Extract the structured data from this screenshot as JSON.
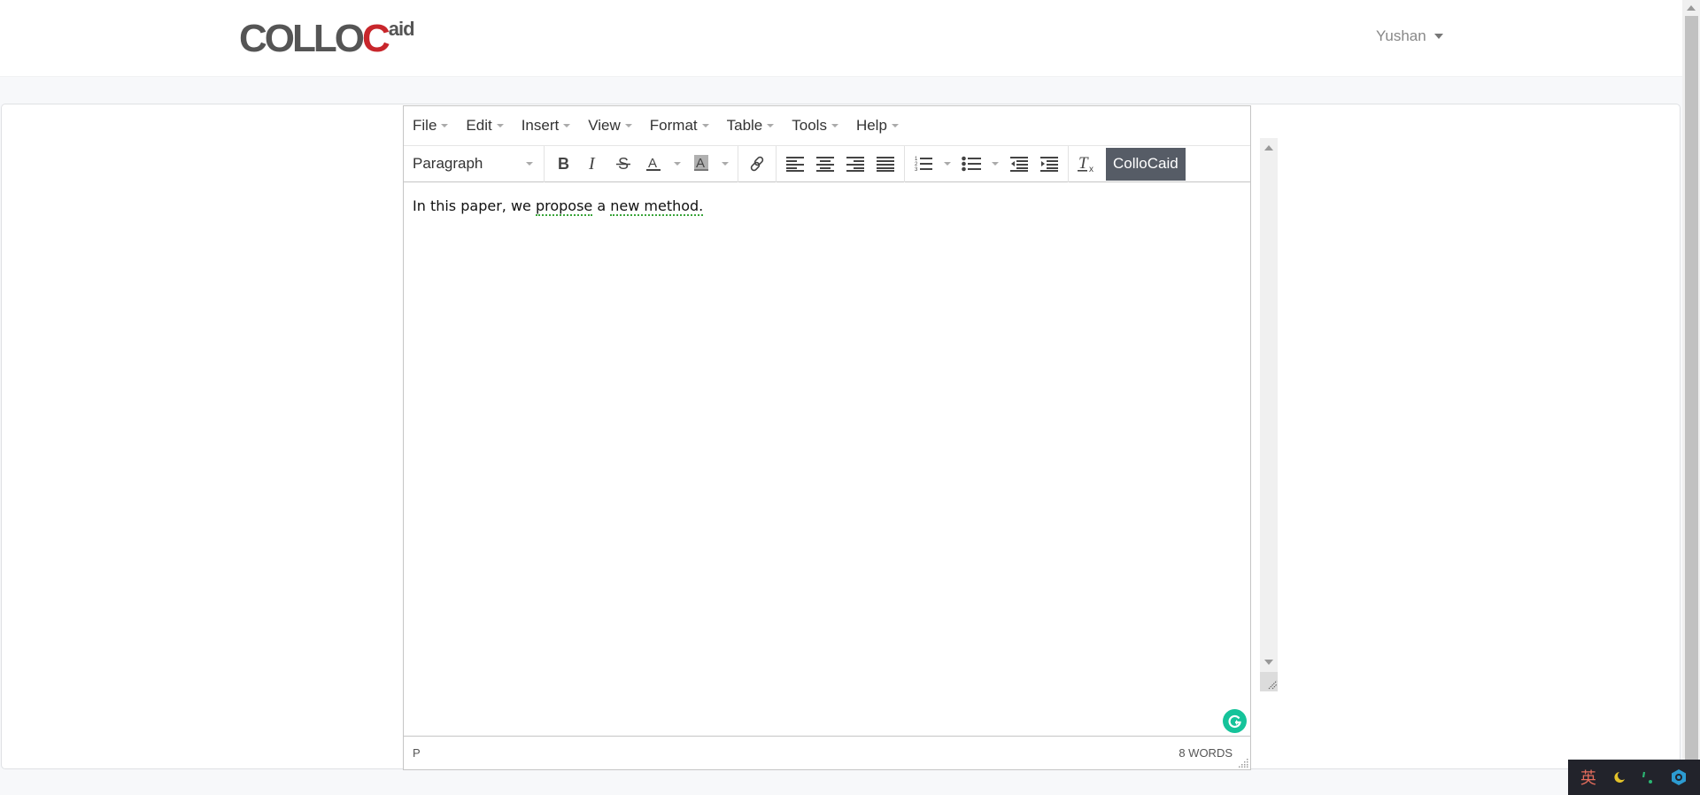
{
  "brand": {
    "logo_main": "COLLO",
    "logo_accent": "C",
    "logo_sup": "aid",
    "accent_color": "#c8262b"
  },
  "user_menu": {
    "label": "Yushan",
    "icon": "caret-down-icon"
  },
  "editor": {
    "menubar": [
      {
        "label": "File"
      },
      {
        "label": "Edit"
      },
      {
        "label": "Insert"
      },
      {
        "label": "View"
      },
      {
        "label": "Format"
      },
      {
        "label": "Table"
      },
      {
        "label": "Tools"
      },
      {
        "label": "Help"
      }
    ],
    "toolbar": {
      "block_format": "Paragraph",
      "buttons": [
        {
          "name": "bold",
          "icon": "bold-icon"
        },
        {
          "name": "italic",
          "icon": "italic-icon"
        },
        {
          "name": "strikethrough",
          "icon": "strikethrough-icon"
        },
        {
          "name": "text-color",
          "icon": "text-color-icon"
        },
        {
          "name": "background-color",
          "icon": "highlight-icon"
        },
        {
          "name": "link",
          "icon": "link-icon"
        },
        {
          "name": "align-left",
          "icon": "align-left-icon"
        },
        {
          "name": "align-center",
          "icon": "align-center-icon"
        },
        {
          "name": "align-right",
          "icon": "align-right-icon"
        },
        {
          "name": "justify",
          "icon": "align-justify-icon"
        },
        {
          "name": "numbered-list",
          "icon": "numbered-list-icon"
        },
        {
          "name": "bullet-list",
          "icon": "bullet-list-icon"
        },
        {
          "name": "outdent",
          "icon": "outdent-icon"
        },
        {
          "name": "indent",
          "icon": "indent-icon"
        },
        {
          "name": "clear-formatting",
          "icon": "clear-format-icon"
        }
      ],
      "plugin_button": "ColloCaid"
    },
    "content": {
      "segments": [
        {
          "text": "In this paper, we ",
          "flag": false
        },
        {
          "text": "propose",
          "flag": true
        },
        {
          "text": " a ",
          "flag": false
        },
        {
          "text": "new method.",
          "flag": true
        }
      ]
    },
    "status": {
      "path": "P",
      "word_count": "8 WORDS"
    },
    "grammarly_color": "#15c39a"
  },
  "ime": {
    "language": "英",
    "icons": [
      "moon-icon",
      "punctuation-icon",
      "settings-icon"
    ]
  }
}
